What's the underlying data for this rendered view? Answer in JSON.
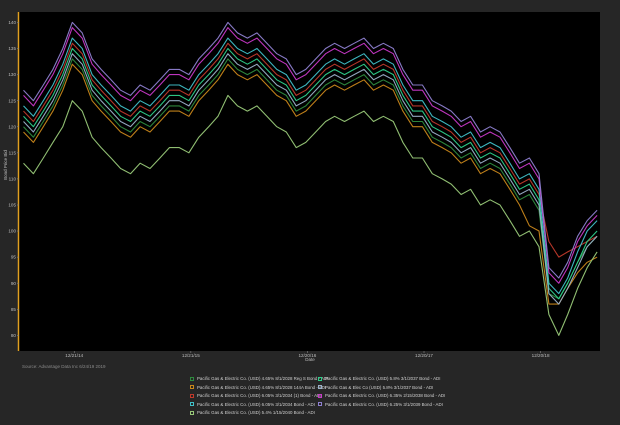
{
  "source_text": "Source: Advantage Data Inc 6/24/19 2019",
  "chart_data": {
    "type": "line",
    "title": "",
    "xlabel": "Date",
    "ylabel": "Bond Price Bid",
    "ylim": [
      77,
      142
    ],
    "yticks": [
      80,
      85,
      90,
      95,
      100,
      105,
      110,
      115,
      120,
      125,
      130,
      135,
      140
    ],
    "xticks": [
      "12/21/14",
      "12/21/15",
      "12/20/16",
      "12/20/17",
      "12/20/18"
    ],
    "x_range": [
      "2014-07-01",
      "2019-06-24"
    ],
    "grid": false,
    "legend_position": "bottom",
    "x": [
      "2014-07",
      "2014-08",
      "2014-09",
      "2014-10",
      "2014-11",
      "2014-12",
      "2015-01",
      "2015-02",
      "2015-03",
      "2015-04",
      "2015-05",
      "2015-06",
      "2015-07",
      "2015-08",
      "2015-09",
      "2015-10",
      "2015-11",
      "2015-12",
      "2016-01",
      "2016-02",
      "2016-03",
      "2016-04",
      "2016-05",
      "2016-06",
      "2016-07",
      "2016-08",
      "2016-09",
      "2016-10",
      "2016-11",
      "2016-12",
      "2017-01",
      "2017-02",
      "2017-03",
      "2017-04",
      "2017-05",
      "2017-06",
      "2017-07",
      "2017-08",
      "2017-09",
      "2017-10",
      "2017-11",
      "2017-12",
      "2018-01",
      "2018-02",
      "2018-03",
      "2018-04",
      "2018-05",
      "2018-06",
      "2018-07",
      "2018-08",
      "2018-09",
      "2018-10",
      "2018-11",
      "2018-12",
      "2019-01",
      "2019-02",
      "2019-03",
      "2019-04",
      "2019-05",
      "2019-06"
    ],
    "series": [
      {
        "name": "Pacific Gas & Electric Co. (USD) 4.65% 8/1/2028 Reg S Bond - ADI",
        "color": "#2e8b3e",
        "values": [
          120,
          118,
          121,
          124,
          128,
          133,
          131,
          126,
          124,
          122,
          120,
          119,
          121,
          120,
          122,
          124,
          124,
          123,
          126,
          128,
          130,
          133,
          131,
          130,
          131,
          129,
          127,
          126,
          123,
          124,
          126,
          128,
          129,
          128,
          129,
          130,
          128,
          129,
          128,
          124,
          121,
          121,
          118,
          117,
          116,
          114,
          115,
          112,
          113,
          112,
          109,
          106,
          107,
          104,
          88,
          87,
          90,
          94,
          97,
          99
        ]
      },
      {
        "name": "Pacific Gas & Electric Co. (USD) 4.65% 8/1/2028 144A Bond - ADI",
        "color": "#c8861a",
        "values": [
          119,
          117,
          120,
          123,
          127,
          132,
          130,
          125,
          123,
          121,
          119,
          118,
          120,
          119,
          121,
          123,
          123,
          122,
          125,
          127,
          129,
          132,
          130,
          129,
          130,
          128,
          126,
          125,
          122,
          123,
          125,
          127,
          128,
          127,
          128,
          129,
          127,
          128,
          127,
          123,
          120,
          120,
          117,
          116,
          115,
          113,
          114,
          111,
          112,
          111,
          108,
          105,
          101,
          100,
          86,
          86,
          89,
          92,
          94,
          95
        ]
      },
      {
        "name": "Pacific Gas & Electric Co. (USD) 6.05% 3/1/2034 (1) Bond - ADI",
        "color": "#c0392b",
        "values": [
          123,
          121,
          124,
          127,
          131,
          136,
          134,
          129,
          127,
          125,
          123,
          122,
          124,
          123,
          125,
          127,
          127,
          126,
          129,
          131,
          133,
          136,
          134,
          133,
          134,
          132,
          130,
          129,
          126,
          127,
          129,
          131,
          132,
          131,
          132,
          133,
          131,
          132,
          131,
          127,
          124,
          124,
          121,
          120,
          119,
          117,
          118,
          115,
          116,
          115,
          112,
          109,
          110,
          107,
          98,
          95,
          96,
          97,
          98,
          99
        ]
      },
      {
        "name": "Pacific Gas & Electric Co. (USD) 6.05% 3/1/2034 Bond - ADI",
        "color": "#40c0c8",
        "values": [
          124,
          122,
          125,
          128,
          132,
          137,
          135,
          130,
          128,
          126,
          124,
          123,
          125,
          124,
          126,
          128,
          128,
          127,
          130,
          132,
          134,
          137,
          135,
          134,
          135,
          133,
          131,
          130,
          127,
          128,
          130,
          132,
          133,
          132,
          133,
          134,
          132,
          133,
          132,
          128,
          125,
          125,
          122,
          121,
          120,
          118,
          119,
          116,
          117,
          116,
          113,
          110,
          111,
          108,
          90,
          88,
          91,
          96,
          100,
          102
        ]
      },
      {
        "name": "Pacific Gas & Electric Co. (USD) 5.8% 3/1/2037 Bond - ADI",
        "color": "#2ecf8a",
        "values": [
          122,
          120,
          123,
          126,
          130,
          135,
          133,
          128,
          126,
          124,
          122,
          121,
          123,
          122,
          124,
          126,
          126,
          125,
          128,
          130,
          132,
          135,
          133,
          132,
          133,
          131,
          129,
          128,
          125,
          126,
          128,
          130,
          131,
          130,
          131,
          132,
          130,
          131,
          130,
          126,
          123,
          123,
          120,
          119,
          118,
          116,
          117,
          114,
          115,
          114,
          111,
          108,
          109,
          106,
          89,
          87,
          90,
          94,
          98,
          100
        ]
      },
      {
        "name": "Pacific Gas & Elec Co (USD) 5.8% 3/1/2037 Bond - ADI",
        "color": "#9ab0c8",
        "values": [
          121,
          119,
          122,
          125,
          129,
          134,
          132,
          127,
          125,
          123,
          121,
          120,
          122,
          121,
          123,
          125,
          125,
          124,
          127,
          129,
          131,
          134,
          132,
          131,
          132,
          130,
          128,
          127,
          124,
          125,
          127,
          129,
          130,
          129,
          130,
          131,
          129,
          130,
          129,
          125,
          122,
          122,
          119,
          118,
          117,
          115,
          116,
          113,
          114,
          113,
          110,
          107,
          108,
          105,
          88,
          86,
          89,
          93,
          97,
          99
        ]
      },
      {
        "name": "Pacific Gas & Electric Co. (USD) 6.35% 2/15/2038 Bond - ADI",
        "color": "#c838c8",
        "values": [
          126,
          124,
          127,
          130,
          134,
          139,
          137,
          132,
          130,
          128,
          126,
          125,
          127,
          126,
          128,
          130,
          130,
          129,
          132,
          134,
          136,
          139,
          137,
          136,
          137,
          135,
          133,
          132,
          129,
          130,
          132,
          134,
          135,
          134,
          135,
          136,
          134,
          135,
          134,
          130,
          127,
          127,
          124,
          123,
          122,
          120,
          121,
          118,
          119,
          118,
          115,
          112,
          113,
          110,
          92,
          90,
          93,
          98,
          101,
          103
        ]
      },
      {
        "name": "Pacific Gas & Electric Co. (USD) 6.25% 3/1/2039 Bond - ADI",
        "color": "#8e7fd0",
        "values": [
          127,
          125,
          128,
          131,
          135,
          140,
          138,
          133,
          131,
          129,
          127,
          126,
          128,
          127,
          129,
          131,
          131,
          130,
          133,
          135,
          137,
          140,
          138,
          137,
          138,
          136,
          134,
          133,
          130,
          131,
          133,
          135,
          136,
          135,
          136,
          137,
          135,
          136,
          135,
          131,
          128,
          128,
          125,
          124,
          123,
          121,
          122,
          119,
          120,
          119,
          116,
          113,
          114,
          111,
          93,
          91,
          94,
          99,
          102,
          104
        ]
      },
      {
        "name": "Pacific Gas & Electric Co. (USD) 5.4% 1/15/2040 Bond - ADI",
        "color": "#98c878",
        "values": [
          113,
          111,
          114,
          117,
          120,
          125,
          123,
          118,
          116,
          114,
          112,
          111,
          113,
          112,
          114,
          116,
          116,
          115,
          118,
          120,
          122,
          126,
          124,
          123,
          124,
          122,
          120,
          119,
          116,
          117,
          119,
          121,
          122,
          121,
          122,
          123,
          121,
          122,
          121,
          117,
          114,
          114,
          111,
          110,
          109,
          107,
          108,
          105,
          106,
          105,
          102,
          99,
          100,
          97,
          84,
          80,
          84,
          89,
          93,
          96
        ]
      }
    ]
  }
}
